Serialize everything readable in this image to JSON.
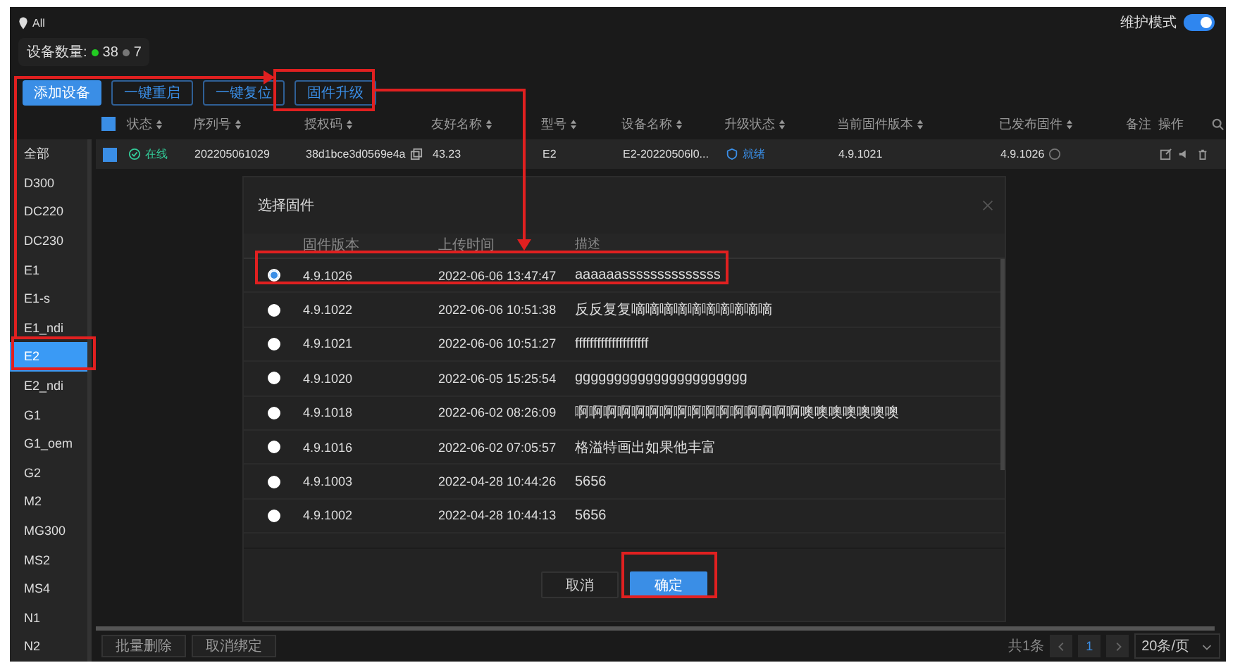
{
  "header": {
    "scope": "All",
    "maintenance_mode": {
      "label": "维护模式",
      "on": true
    }
  },
  "device_count": {
    "label": "设备数量:",
    "online": "38",
    "offline": "7"
  },
  "toolbar": [
    {
      "label": "添加设备",
      "kind": "primary"
    },
    {
      "label": "一键重启",
      "kind": "outline"
    },
    {
      "label": "一键复位",
      "kind": "outline"
    },
    {
      "label": "固件升级",
      "kind": "outline"
    }
  ],
  "table": {
    "columns": [
      "状态",
      "序列号",
      "授权码",
      "友好名称",
      "型号",
      "设备名称",
      "升级状态",
      "当前固件版本",
      "已发布固件"
    ],
    "remark_column": "备注",
    "actions_column": "操作",
    "rows": [
      {
        "checked": true,
        "status": "在线",
        "serial": "202205061029",
        "auth_code": "38d1bce3d0569e4a",
        "friendly_name": "43.23",
        "model": "E2",
        "device_name": "E2-20220506l0...",
        "upgrade_status": "就绪",
        "current_firmware": "4.9.1021",
        "published_firmware": "4.9.1026"
      }
    ]
  },
  "header_checkbox": {
    "checked": true
  },
  "sidebar": {
    "items": [
      {
        "label": "全部",
        "selected": false
      },
      {
        "label": "D300",
        "selected": false
      },
      {
        "label": "DC220",
        "selected": false
      },
      {
        "label": "DC230",
        "selected": false
      },
      {
        "label": "E1",
        "selected": false
      },
      {
        "label": "E1-s",
        "selected": false
      },
      {
        "label": "E1_ndi",
        "selected": false
      },
      {
        "label": "E2",
        "selected": true
      },
      {
        "label": "E2_ndi",
        "selected": false
      },
      {
        "label": "G1",
        "selected": false
      },
      {
        "label": "G1_oem",
        "selected": false
      },
      {
        "label": "G2",
        "selected": false
      },
      {
        "label": "M2",
        "selected": false
      },
      {
        "label": "MG300",
        "selected": false
      },
      {
        "label": "MS2",
        "selected": false
      },
      {
        "label": "MS4",
        "selected": false
      },
      {
        "label": "N1",
        "selected": false
      },
      {
        "label": "N2",
        "selected": false
      }
    ]
  },
  "bottom_bar": {
    "buttons": [
      "批量删除",
      "取消绑定"
    ],
    "total": "共1条",
    "page": "1",
    "page_size": "20条/页"
  },
  "dialog": {
    "title": "选择固件",
    "columns": [
      "固件版本",
      "上传时间",
      "描述"
    ],
    "rows": [
      {
        "selected": true,
        "version": "4.9.1026",
        "time": "2022-06-06 13:47:47",
        "description": "aaaaaassssssssssssss"
      },
      {
        "selected": false,
        "version": "4.9.1022",
        "time": "2022-06-06 10:51:38",
        "description": "反反复复嘀嘀嘀嘀嘀嘀嘀嘀嘀嘀"
      },
      {
        "selected": false,
        "version": "4.9.1021",
        "time": "2022-06-06 10:51:27",
        "description": "ffffffffffffffffffff"
      },
      {
        "selected": false,
        "version": "4.9.1020",
        "time": "2022-06-05 15:25:54",
        "description": "gggggggggggggggggggggg"
      },
      {
        "selected": false,
        "version": "4.9.1018",
        "time": "2022-06-02 08:26:09",
        "description": "啊啊啊啊啊啊啊啊啊啊啊啊啊啊啊啊噢噢噢噢噢噢噢"
      },
      {
        "selected": false,
        "version": "4.9.1016",
        "time": "2022-06-02 07:05:57",
        "description": "格溢特画出如果他丰富"
      },
      {
        "selected": false,
        "version": "4.9.1003",
        "time": "2022-04-28 10:44:26",
        "description": "5656"
      },
      {
        "selected": false,
        "version": "4.9.1002",
        "time": "2022-04-28 10:44:13",
        "description": "5656"
      }
    ],
    "buttons": [
      {
        "label": "取消",
        "kind": "default"
      },
      {
        "label": "确定",
        "kind": "primary"
      }
    ]
  }
}
